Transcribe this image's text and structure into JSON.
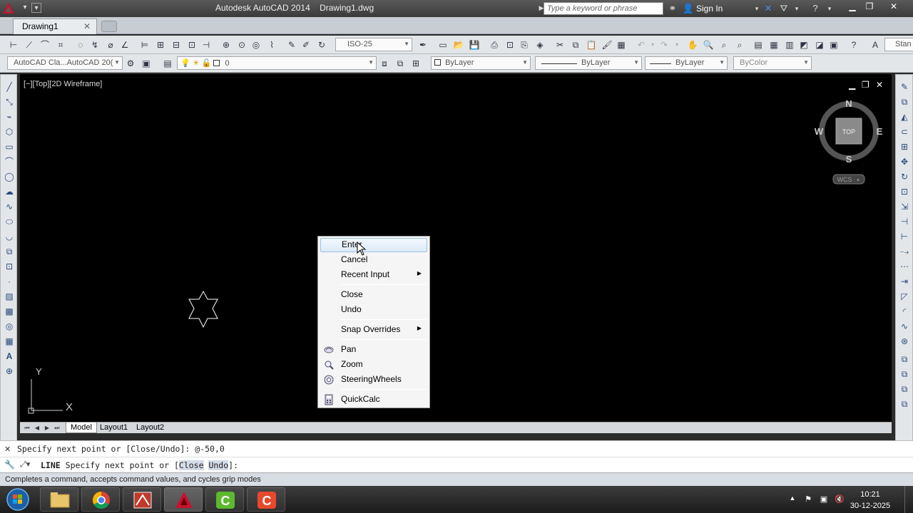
{
  "window": {
    "title": "Autodesk AutoCAD 2014    Drawing1.dwg",
    "search_placeholder": "Type a keyword or phrase",
    "sign_in": "Sign In"
  },
  "doc_tabs": [
    {
      "label": "Drawing1"
    }
  ],
  "toolbar": {
    "dimstyle": "ISO-25",
    "workspace": "AutoCAD Cla...AutoCAD 20(",
    "layer": "0",
    "color": "ByLayer",
    "linetype": "ByLayer",
    "lineweight": "ByLayer",
    "plotstyle": "ByColor",
    "textstyle": "Stan"
  },
  "viewport": {
    "label": "[−][Top][2D Wireframe]",
    "viewcube": {
      "north": "N",
      "south": "S",
      "east": "E",
      "west": "W",
      "face": "TOP",
      "ucs": "WCS"
    },
    "ucs_x": "X",
    "ucs_y": "Y"
  },
  "context_menu": {
    "items": [
      {
        "label": "Enter",
        "highlighted": true
      },
      {
        "label": "Cancel"
      },
      {
        "label": "Recent Input",
        "submenu": true
      },
      {
        "label": "Close"
      },
      {
        "label": "Undo"
      },
      {
        "label": "Snap Overrides",
        "submenu": true
      },
      {
        "label": "Pan",
        "icon": "pan-icon"
      },
      {
        "label": "Zoom",
        "icon": "zoom-icon"
      },
      {
        "label": "SteeringWheels",
        "icon": "steering-wheel-icon"
      },
      {
        "label": "QuickCalc",
        "icon": "calculator-icon"
      }
    ]
  },
  "layout_tabs": [
    "Model",
    "Layout1",
    "Layout2"
  ],
  "command_line": {
    "history": "Specify next point or [Close/Undo]: @-50,0",
    "prompt_cmd": "LINE",
    "prompt_pre": "Specify next point or [",
    "opt1": "Close",
    "opt2": "Undo",
    "prompt_post": "]:"
  },
  "status_bar": {
    "text": "Completes a command, accepts command values, and cycles grip modes"
  },
  "taskbar": {
    "time": "10:21",
    "date": "30-12-2025"
  },
  "colors": {
    "canvas": "#000000",
    "menu_highlight": "#dceaf8",
    "autocad_red": "#c8102e"
  }
}
